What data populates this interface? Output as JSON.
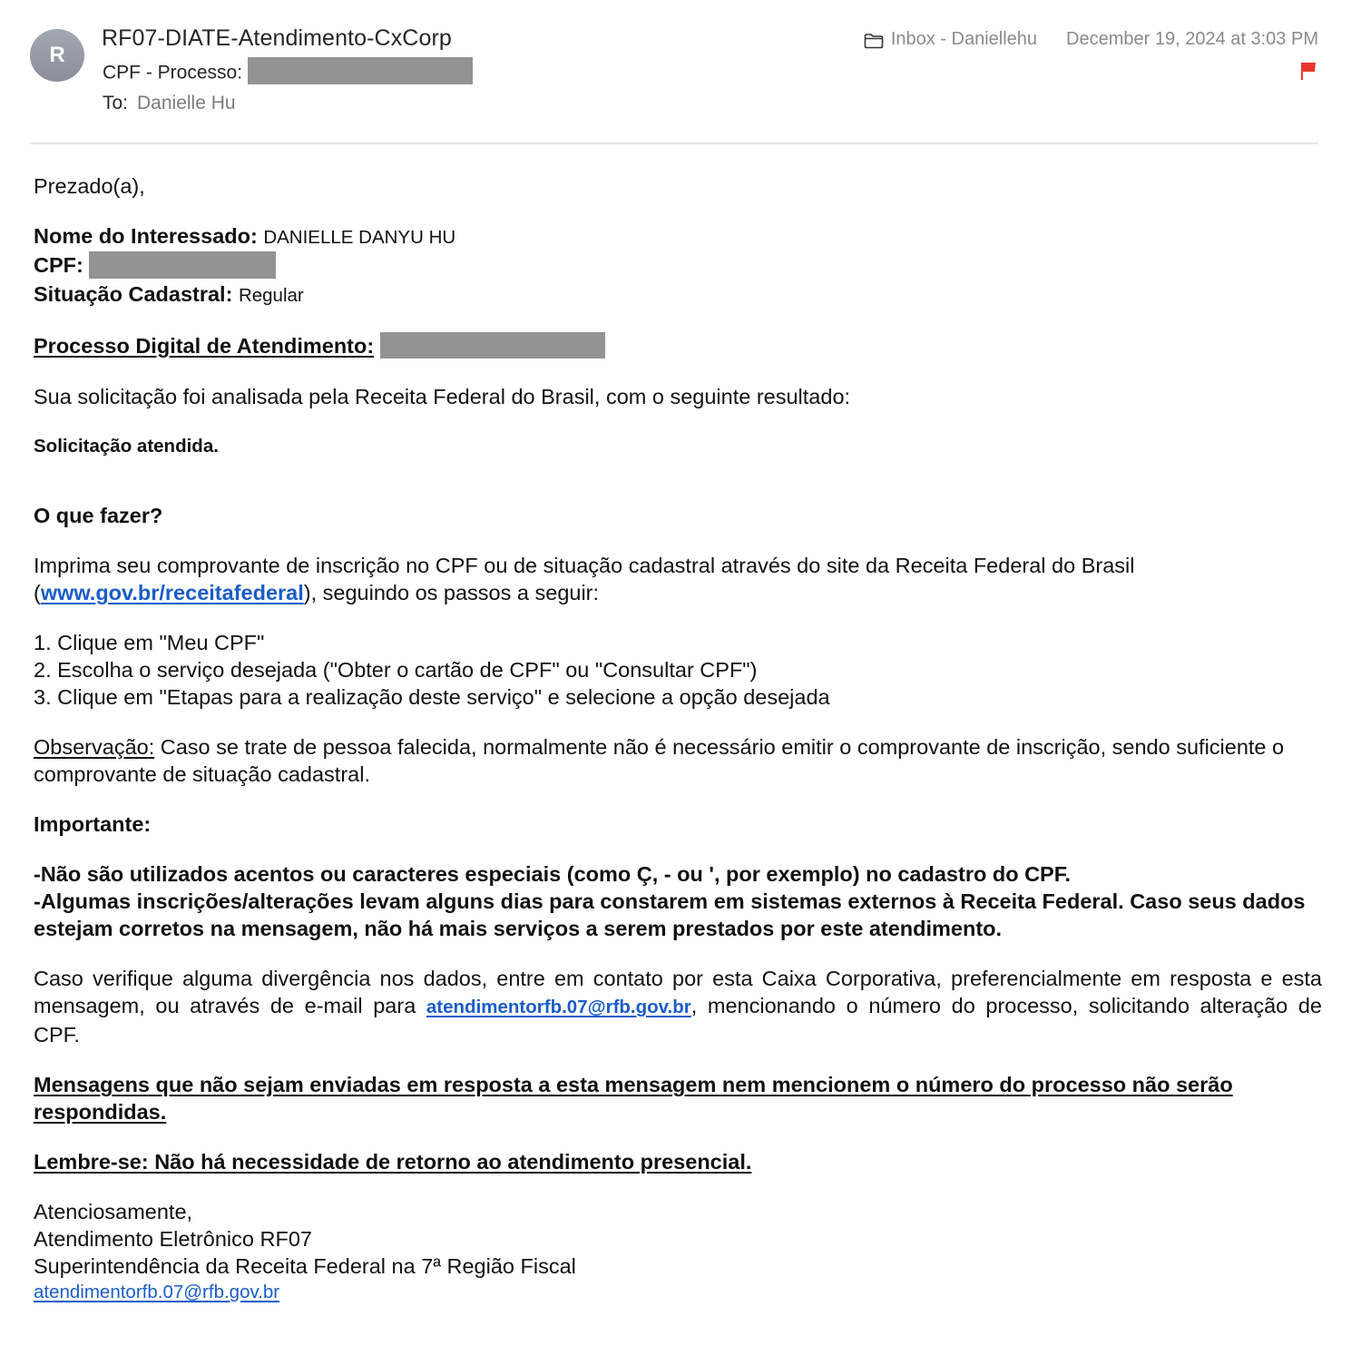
{
  "header": {
    "avatar_initial": "R",
    "sender": "RF07-DIATE-Atendimento-CxCorp",
    "subject_label": "CPF - Processo:",
    "subject_value_redacted": true,
    "to_label": "To:",
    "to_value": "Danielle Hu",
    "mailbox": "Inbox - Daniellehu",
    "date": "December 19, 2024 at 3:03 PM",
    "flag_color": "#e8352c",
    "icons": {
      "folder": "folder-icon",
      "flag": "flag-icon"
    }
  },
  "body": {
    "greeting": "Prezado(a),",
    "interessado_label": "Nome do Interessado:",
    "interessado_value": "DANIELLE DANYU HU",
    "cpf_label": "CPF:",
    "situacao_label": "Situação Cadastral:",
    "situacao_value": "Regular",
    "processo_label": "Processo Digital de Atendimento:",
    "analysis_text": "Sua solicitação foi analisada pela Receita Federal do Brasil, com o seguinte resultado:",
    "result": "Solicitação atendida.",
    "what_to_do_heading": "O que fazer?",
    "instructions_line1": "Imprima seu comprovante de inscrição no CPF ou de situação cadastral através do site da Receita Federal do Brasil",
    "instructions_open_paren": "(",
    "site_link": "www.gov.br/receitafederal",
    "instructions_line2_rest": "), seguindo os passos a seguir:",
    "steps": [
      "1. Clique em \"Meu CPF\"",
      "2. Escolha o serviço desejada (\"Obter o cartão de CPF\" ou \"Consultar CPF\")",
      "3. Clique em \"Etapas para a realização deste serviço\" e selecione a opção desejada"
    ],
    "observacao_label": "Observação:",
    "observacao_text": " Caso se trate de pessoa falecida, normalmente não é necessário emitir o comprovante de inscrição, sendo suficiente o comprovante de situação cadastral.",
    "importante_heading": "Importante:",
    "important_items": [
      "-Não são utilizados acentos ou caracteres especiais (como Ç, - ou ', por exemplo) no cadastro do CPF.",
      "-Algumas inscrições/alterações levam alguns dias para constarem em sistemas externos à Receita Federal. Caso seus dados estejam corretos na mensagem, não há mais serviços a serem prestados por este atendimento."
    ],
    "divergence_part1": "Caso verifique alguma divergência nos dados, entre em contato por esta Caixa Corporativa, preferencialmente em resposta e esta mensagem, ou através de e-mail para ",
    "divergence_email": "atendimentorfb.07@rfb.gov.br",
    "divergence_part2": ", mencionando o número do processo, solicitando alteração de CPF.",
    "warning": "Mensagens que não sejam enviadas em resposta a esta mensagem nem mencionem o número do processo não serão respondidas.",
    "reminder": "Lembre-se: Não há necessidade de retorno ao atendimento presencial."
  },
  "signature": {
    "closing": "Atenciosamente,",
    "line1": "Atendimento Eletrônico RF07",
    "line2": "Superintendência da Receita Federal na 7ª Região Fiscal",
    "email": "atendimentorfb.07@rfb.gov.br"
  }
}
